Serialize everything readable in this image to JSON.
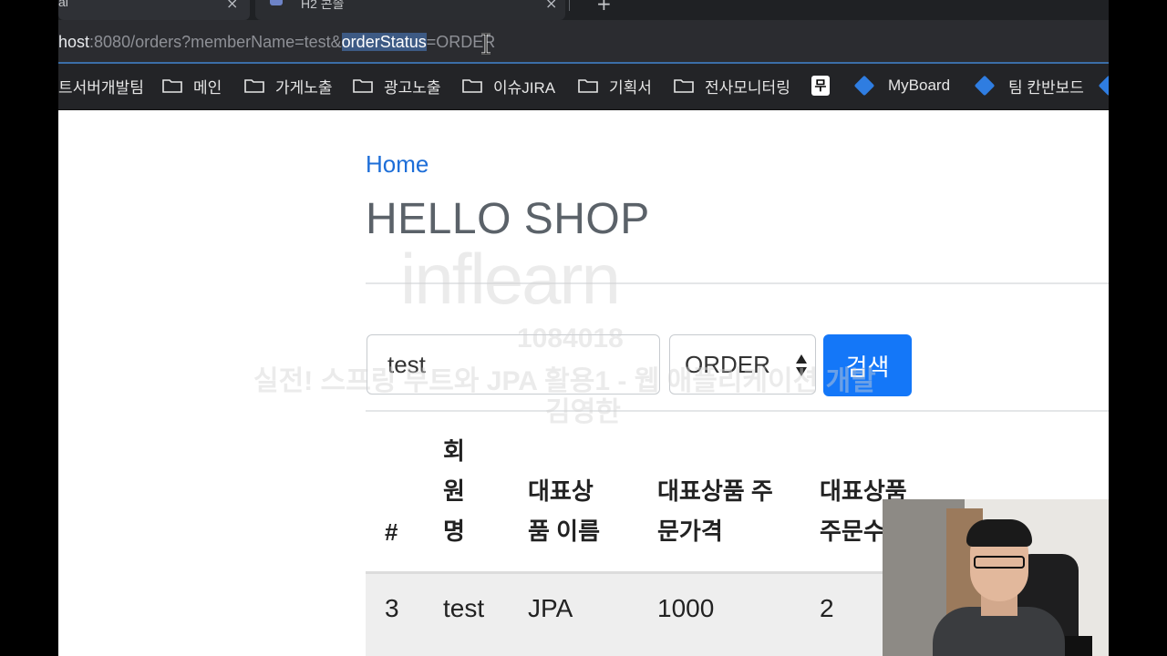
{
  "browser": {
    "tabs": [
      {
        "label": "al",
        "close": "×"
      },
      {
        "label": "H2 콘솔",
        "close": "×"
      }
    ],
    "new_tab": "+",
    "url": {
      "prefix": "host",
      "middle": ":8080/orders?memberName=test&",
      "selected": "orderStatus",
      "suffix": "=ORDER"
    },
    "bookmarks": [
      {
        "label": "트서버개발팀",
        "icon": "none"
      },
      {
        "label": "메인",
        "icon": "folder-icon"
      },
      {
        "label": "가게노출",
        "icon": "folder-icon"
      },
      {
        "label": "광고노출",
        "icon": "folder-icon"
      },
      {
        "label": "이슈JIRA",
        "icon": "folder-icon"
      },
      {
        "label": "기획서",
        "icon": "folder-icon"
      },
      {
        "label": "전사모니터링",
        "icon": "folder-icon"
      },
      {
        "label": "무",
        "icon": "mu-icon"
      },
      {
        "label": "MyBoard",
        "icon": "jira-icon"
      },
      {
        "label": "팀 칸반보드",
        "icon": "jira-icon"
      }
    ]
  },
  "page": {
    "home_link": "Home",
    "title": "HELLO SHOP",
    "search": {
      "member_name_value": "test",
      "status_selected": "ORDER",
      "submit_label": "검색"
    },
    "table": {
      "headers": [
        "#",
        "회\n원\n명",
        "대표상\n품 이름",
        "대표상품 주\n문가격",
        "대표상품\n주문수"
      ],
      "rows": [
        [
          "3",
          "test",
          "JPA",
          "1000",
          "2"
        ]
      ]
    }
  },
  "watermark": {
    "brand": "inflearn",
    "id": "1084018",
    "course": "실전! 스프링 부트와 JPA 활용1 - 웹 애플리케이션 개발",
    "author": "김영한"
  },
  "colors": {
    "link": "#1d6ed8",
    "button": "#1477f8",
    "title": "#5b6269",
    "url_selection": "#3d5a84"
  }
}
